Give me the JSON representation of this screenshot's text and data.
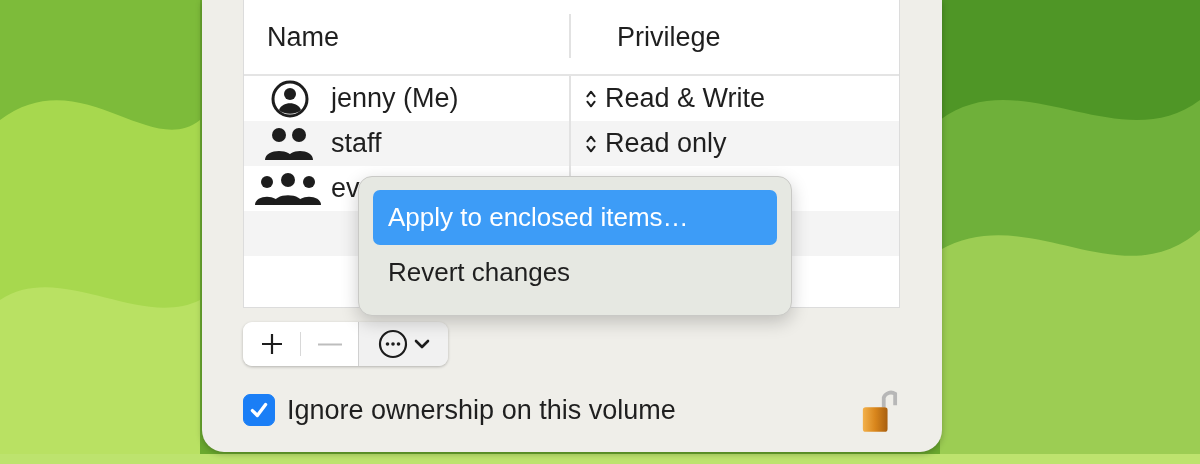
{
  "table": {
    "columns": [
      "Name",
      "Privilege"
    ],
    "rows": [
      {
        "kind": "user",
        "name": "jenny (Me)",
        "privilege": "Read & Write"
      },
      {
        "kind": "group",
        "name": "staff",
        "privilege": "Read only"
      },
      {
        "kind": "everyone",
        "name": "ev"
      }
    ]
  },
  "context_menu": {
    "items": [
      {
        "label": "Apply to enclosed items…",
        "selected": true
      },
      {
        "label": "Revert changes",
        "selected": false
      }
    ]
  },
  "ignore_ownership": {
    "label": "Ignore ownership on this volume",
    "checked": true
  },
  "locked": false
}
